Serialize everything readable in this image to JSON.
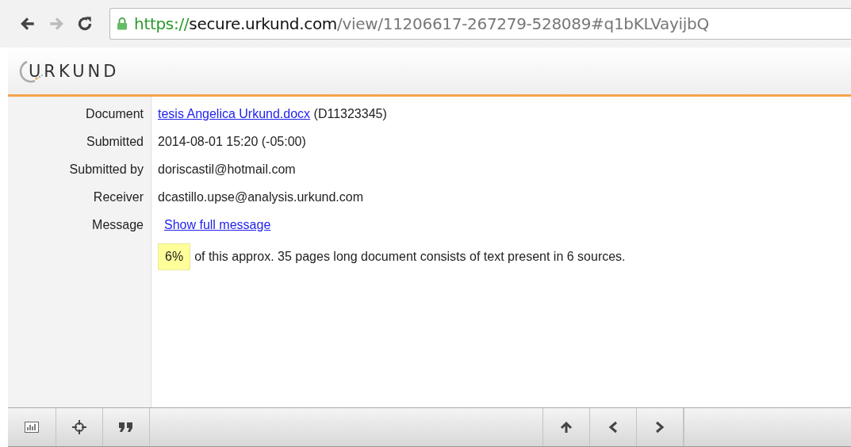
{
  "browser": {
    "url_parts": [
      {
        "kind": "scheme",
        "text": "https://"
      },
      {
        "kind": "host",
        "text": "secure.urkund.com"
      },
      {
        "kind": "path",
        "text": "/view/11206617-267279-528089#q1bKLVayijbQ"
      }
    ],
    "secure": true
  },
  "app": {
    "logo": "URKUND"
  },
  "details": [
    {
      "label": "Document",
      "kind": "link",
      "link": "tesis Angelica Urkund.docx",
      "extra": " (D11323345)"
    },
    {
      "label": "Submitted",
      "kind": "text",
      "value": "2014-08-01 15:20 (-05:00)"
    },
    {
      "label": "Submitted by",
      "kind": "text",
      "value": "doriscastil@hotmail.com"
    },
    {
      "label": "Receiver",
      "kind": "text",
      "value": "dcastillo.upse@analysis.urkund.com"
    },
    {
      "label": "Message",
      "kind": "action",
      "link": "Show full message"
    }
  ],
  "summary": {
    "percent": "6%",
    "text": "of this approx. 35 pages long document consists of text present in 6 sources."
  }
}
